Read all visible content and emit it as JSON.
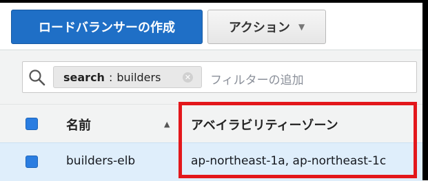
{
  "toolbar": {
    "create_label": "ロードバランサーの作成",
    "actions_label": "アクション"
  },
  "filter": {
    "token_key": "search",
    "token_separator": ":",
    "token_value": "builders",
    "placeholder": "フィルターの追加"
  },
  "table": {
    "columns": [
      {
        "label": "名前",
        "sort": "ascending"
      },
      {
        "label": "アベイラビリティーゾーン"
      }
    ],
    "rows": [
      {
        "name": "builders-elb",
        "availability_zones": "ap-northeast-1a, ap-northeast-1c",
        "selected": true
      }
    ]
  },
  "annotation": {
    "color": "#e3171b"
  },
  "colors": {
    "primary": "#1f6fc6",
    "selected_row": "#dfeefb",
    "checkbox": "#2a7de1"
  }
}
